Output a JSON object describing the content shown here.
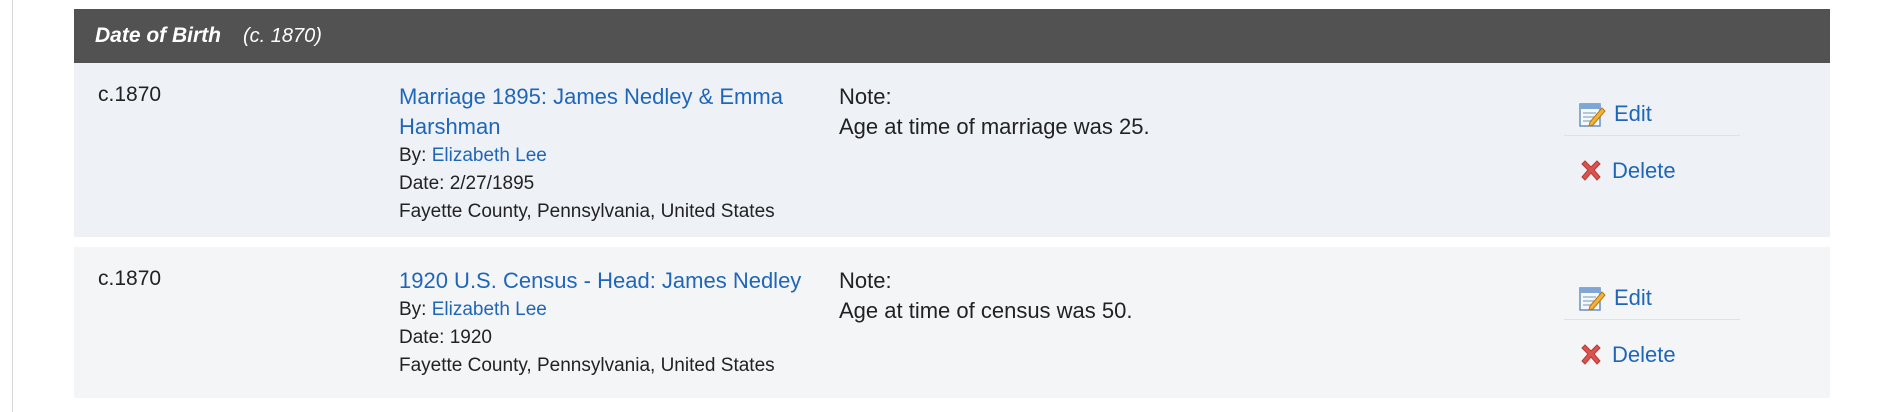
{
  "header": {
    "title": "Date of Birth",
    "date": "(c. 1870)"
  },
  "rows": [
    {
      "date": "c.1870",
      "source_title": "Marriage 1895: James Nedley & Emma Harshman",
      "by_prefix": "By: ",
      "by_name": "Elizabeth Lee",
      "source_date": "Date: 2/27/1895",
      "place": "Fayette County, Pennsylvania, United States",
      "note_label": "Note:",
      "note_text": "Age at time of marriage was 25.",
      "edit_label": "Edit",
      "delete_label": "Delete"
    },
    {
      "date": "c.1870",
      "source_title": "1920 U.S. Census - Head: James Nedley",
      "by_prefix": "By: ",
      "by_name": "Elizabeth Lee",
      "source_date": "Date: 1920",
      "place": "Fayette County, Pennsylvania, United States",
      "note_label": "Note:",
      "note_text": "Age at time of census was 50.",
      "edit_label": "Edit",
      "delete_label": "Delete"
    }
  ],
  "icons": {
    "edit": "edit-icon",
    "delete": "delete-icon"
  },
  "colors": {
    "header_bg": "#525252",
    "row1_bg": "#eef2f7",
    "row2_bg": "#f4f5f7",
    "link": "#1f66b8",
    "delete_x": "#d9534f"
  }
}
